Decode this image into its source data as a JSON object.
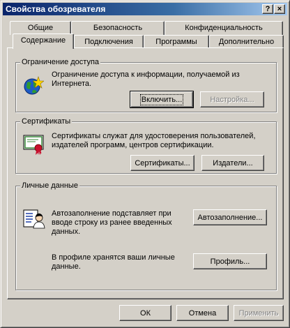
{
  "window": {
    "title": "Свойства обозревателя",
    "help_button": "?",
    "close_button": "×"
  },
  "tabs": {
    "row1": [
      "Общие",
      "Безопасность",
      "Конфиденциальность"
    ],
    "row2": [
      "Содержание",
      "Подключения",
      "Программы",
      "Дополнительно"
    ],
    "active": "Содержание"
  },
  "content_advisor": {
    "title": "Ограничение доступа",
    "description": "Ограничение доступа к информации, получаемой из Интернета.",
    "enable_button": "Включить...",
    "settings_button": "Настройка...",
    "icon": "globe-star-icon"
  },
  "certificates": {
    "title": "Сертификаты",
    "description": "Сертификаты служат для удостоверения пользователей, издателей программ, центров сертификации.",
    "certificates_button": "Сертификаты...",
    "publishers_button": "Издатели...",
    "icon": "certificate-icon"
  },
  "personal": {
    "title": "Личные данные",
    "autocomplete_text": "Автозаполнение подставляет при вводе строку из ранее введенных данных.",
    "autocomplete_button": "Автозаполнение...",
    "profile_text": "В профиле хранятся ваши личные данные.",
    "profile_button": "Профиль...",
    "icon": "profile-card-icon"
  },
  "footer": {
    "ok": "ОК",
    "cancel": "Отмена",
    "apply": "Применить"
  }
}
